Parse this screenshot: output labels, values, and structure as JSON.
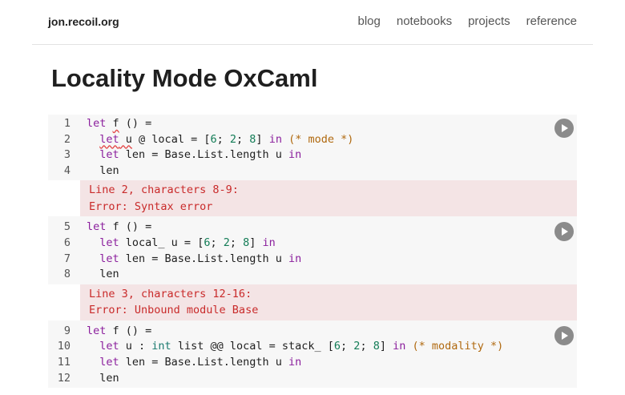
{
  "site": {
    "title": "jon.recoil.org"
  },
  "nav": [
    "blog",
    "notebooks",
    "projects",
    "reference"
  ],
  "page": {
    "title": "Locality Mode OxCaml"
  },
  "cells": [
    {
      "lines": [
        {
          "n": "1",
          "t": [
            [
              "kw",
              "let"
            ],
            [
              "",
              "␣"
            ],
            [
              "err",
              "f"
            ],
            [
              "",
              "␣() ="
            ]
          ]
        },
        {
          "n": "2",
          "t": [
            [
              "",
              "  "
            ],
            [
              "kwerr",
              "let"
            ],
            [
              "err",
              "␣u"
            ],
            [
              "",
              "␣@ local = ["
            ],
            [
              "num",
              "6"
            ],
            [
              "",
              "; "
            ],
            [
              "num",
              "2"
            ],
            [
              "",
              "; "
            ],
            [
              "num",
              "8"
            ],
            [
              "",
              "] "
            ],
            [
              "kw",
              "in"
            ],
            [
              "",
              "␣"
            ],
            [
              "cm",
              "(* mode *)"
            ]
          ]
        },
        {
          "n": "3",
          "t": [
            [
              "",
              "  "
            ],
            [
              "kw",
              "let"
            ],
            [
              "",
              "␣len = Base.List.length u "
            ],
            [
              "kw",
              "in"
            ]
          ]
        },
        {
          "n": "4",
          "t": [
            [
              "",
              "  len"
            ]
          ]
        }
      ],
      "output": [
        "Line 2, characters 8-9:",
        "Error: Syntax error"
      ]
    },
    {
      "lines": [
        {
          "n": "5",
          "t": [
            [
              "kw",
              "let"
            ],
            [
              "",
              "␣f () ="
            ]
          ]
        },
        {
          "n": "6",
          "t": [
            [
              "",
              "  "
            ],
            [
              "kw",
              "let"
            ],
            [
              "",
              "␣local_ u = ["
            ],
            [
              "num",
              "6"
            ],
            [
              "",
              "; "
            ],
            [
              "num",
              "2"
            ],
            [
              "",
              "; "
            ],
            [
              "num",
              "8"
            ],
            [
              "",
              "] "
            ],
            [
              "kw",
              "in"
            ]
          ]
        },
        {
          "n": "7",
          "t": [
            [
              "",
              "  "
            ],
            [
              "kw",
              "let"
            ],
            [
              "",
              "␣len = Base.List.length u "
            ],
            [
              "kw",
              "in"
            ]
          ]
        },
        {
          "n": "8",
          "t": [
            [
              "",
              "  len"
            ]
          ]
        }
      ],
      "output": [
        "Line 3, characters 12-16:",
        "Error: Unbound module Base"
      ]
    },
    {
      "lines": [
        {
          "n": "9",
          "t": [
            [
              "kw",
              "let"
            ],
            [
              "",
              "␣f () ="
            ]
          ]
        },
        {
          "n": "10",
          "t": [
            [
              "",
              "  "
            ],
            [
              "kw",
              "let"
            ],
            [
              "",
              "␣u : "
            ],
            [
              "ty",
              "int"
            ],
            [
              "",
              "␣list @@ local = stack_ ["
            ],
            [
              "num",
              "6"
            ],
            [
              "",
              "; "
            ],
            [
              "num",
              "2"
            ],
            [
              "",
              "; "
            ],
            [
              "num",
              "8"
            ],
            [
              "",
              "] "
            ],
            [
              "kw",
              "in"
            ],
            [
              "",
              "␣"
            ],
            [
              "cm",
              "(* modality *)"
            ]
          ]
        },
        {
          "n": "11",
          "t": [
            [
              "",
              "  "
            ],
            [
              "kw",
              "let"
            ],
            [
              "",
              "␣len = Base.List.length u "
            ],
            [
              "kw",
              "in"
            ]
          ]
        },
        {
          "n": "12",
          "t": [
            [
              "",
              "  len"
            ]
          ]
        }
      ],
      "output": []
    }
  ],
  "icons": {
    "run": "play-icon"
  },
  "colors": {
    "keyword": "#8b1f9d",
    "number": "#127c56",
    "comment": "#b0690f",
    "error": "#c92a2a",
    "errorBg": "#f4e4e5"
  }
}
